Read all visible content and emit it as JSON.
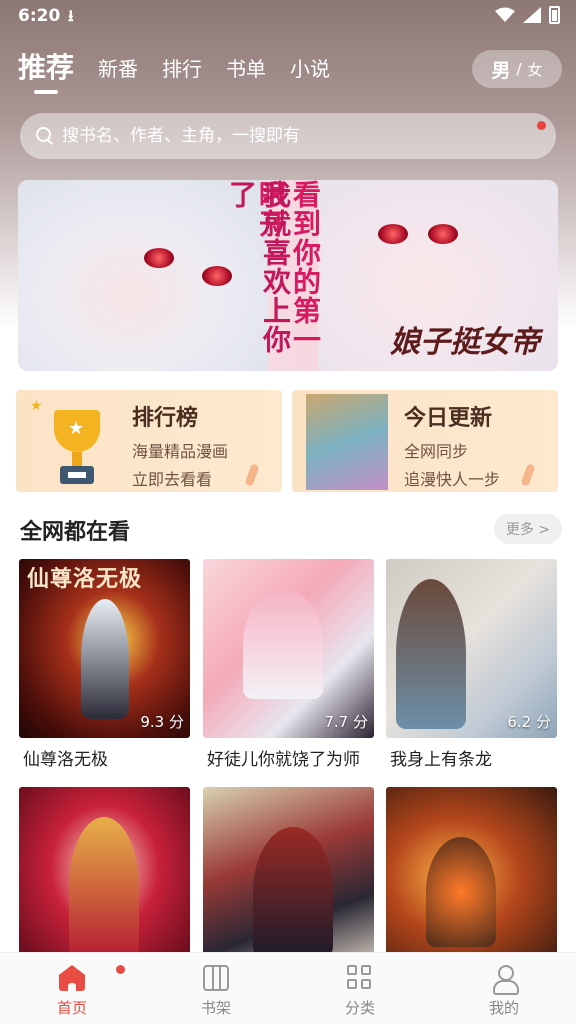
{
  "status_bar": {
    "time": "6:20",
    "download_icon": "download-icon",
    "wifi_icon": "wifi-icon",
    "signal_icon": "signal-icon",
    "battery_icon": "battery-icon"
  },
  "tabs": [
    {
      "label": "推荐",
      "active": true
    },
    {
      "label": "新番",
      "active": false
    },
    {
      "label": "排行",
      "active": false
    },
    {
      "label": "书单",
      "active": false
    },
    {
      "label": "小说",
      "active": false
    }
  ],
  "gender": {
    "male": "男",
    "separator": "/",
    "female": "女",
    "selected": "男"
  },
  "search": {
    "placeholder": "搜书名、作者、主角，一搜即有",
    "icon": "search-icon"
  },
  "banner": {
    "line1": "看到你的第一眼开",
    "line2": "我就喜欢上你了",
    "logo": "娘子挺女帝"
  },
  "promos": {
    "rank": {
      "title": "排行榜",
      "sub1": "海量精品漫画",
      "sub2": "立即去看看",
      "icon": "trophy-icon"
    },
    "today": {
      "title": "今日更新",
      "sub1": "全网同步",
      "sub2": "追漫快人一步"
    }
  },
  "section": {
    "title": "全网都在看",
    "more": "更多 >"
  },
  "books": [
    {
      "title": "仙尊洛无极",
      "score": "9.3 分",
      "cover_text": "仙尊洛无极"
    },
    {
      "title": "好徒儿你就饶了为师",
      "score": "7.7 分",
      "cover_text": ""
    },
    {
      "title": "我身上有条龙",
      "score": "6.2 分",
      "cover_text": ""
    },
    {
      "title": "",
      "score": "",
      "cover_text": ""
    },
    {
      "title": "",
      "score": "",
      "cover_text": ""
    },
    {
      "title": "",
      "score": "",
      "cover_text": ""
    }
  ],
  "bottom_nav": [
    {
      "label": "首页",
      "icon": "home-icon",
      "active": true,
      "badge": true
    },
    {
      "label": "书架",
      "icon": "bookshelf-icon",
      "active": false
    },
    {
      "label": "分类",
      "icon": "category-icon",
      "active": false
    },
    {
      "label": "我的",
      "icon": "profile-icon",
      "active": false
    }
  ],
  "colors": {
    "accent": "#e94c43",
    "promo_bg": "#fde9cf"
  }
}
